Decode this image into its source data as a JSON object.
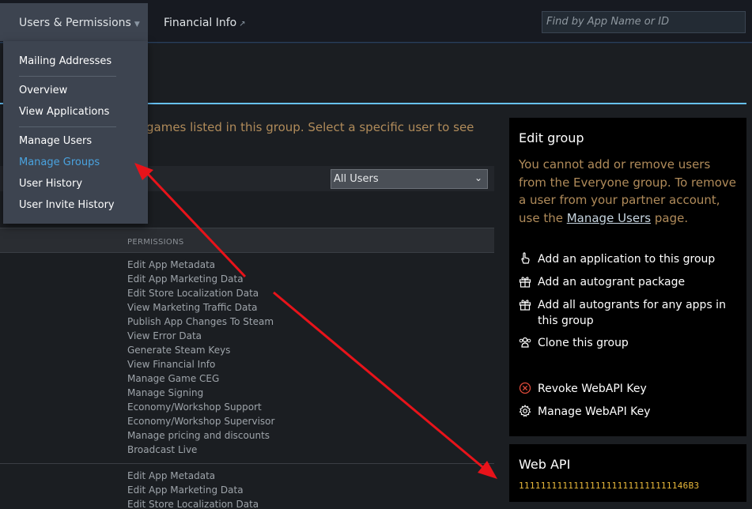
{
  "nav": {
    "users_permissions": "Users & Permissions",
    "financial_info": "Financial Info",
    "search_placeholder": "Find by App Name or ID"
  },
  "dropdown": {
    "items": [
      "Mailing Addresses",
      "Overview",
      "View Applications",
      "Manage Users",
      "Manage Groups",
      "User History",
      "User Invite History"
    ],
    "active": "Manage Groups"
  },
  "intro_text": "games listed in this group. Select a specific user to see",
  "filter": {
    "selected": "All Users"
  },
  "table": {
    "header": "PERMISSIONS",
    "group1": [
      "Edit App Metadata",
      "Edit App Marketing Data",
      "Edit Store Localization Data",
      "View Marketing Traffic Data",
      "Publish App Changes To Steam",
      "View Error Data",
      "Generate Steam Keys",
      "View Financial Info",
      "Manage Game CEG",
      "Manage Signing",
      "Economy/Workshop Support",
      "Economy/Workshop Supervisor",
      "Manage pricing and discounts",
      "Broadcast Live"
    ],
    "group2": [
      "Edit App Metadata",
      "Edit App Marketing Data",
      "Edit Store Localization Data"
    ]
  },
  "edit_group": {
    "title": "Edit group",
    "note_before": "You cannot add or remove users from the Everyone group. To remove a user from your partner account, use the",
    "note_link": "Manage Users",
    "note_after": "page.",
    "actions": [
      {
        "label": "Add an application to this group",
        "icon": "pointer-hand-icon"
      },
      {
        "label": "Add an autogrant package",
        "icon": "gift-icon"
      },
      {
        "label": "Add all autogrants for any apps in this group",
        "icon": "gift-icon"
      },
      {
        "label": "Clone this group",
        "icon": "users-icon"
      },
      {
        "label": "Revoke WebAPI Key",
        "icon": "revoke-icon"
      },
      {
        "label": "Manage WebAPI Key",
        "icon": "gear-icon"
      }
    ]
  },
  "web_api": {
    "title": "Web API",
    "key": "1111111111111111111111111111146B3"
  },
  "colors": {
    "accent_blue": "#67c1f5",
    "note_orange": "#b08b5a",
    "key_yellow": "#e8b83a",
    "annotation_red": "#e8131a"
  }
}
